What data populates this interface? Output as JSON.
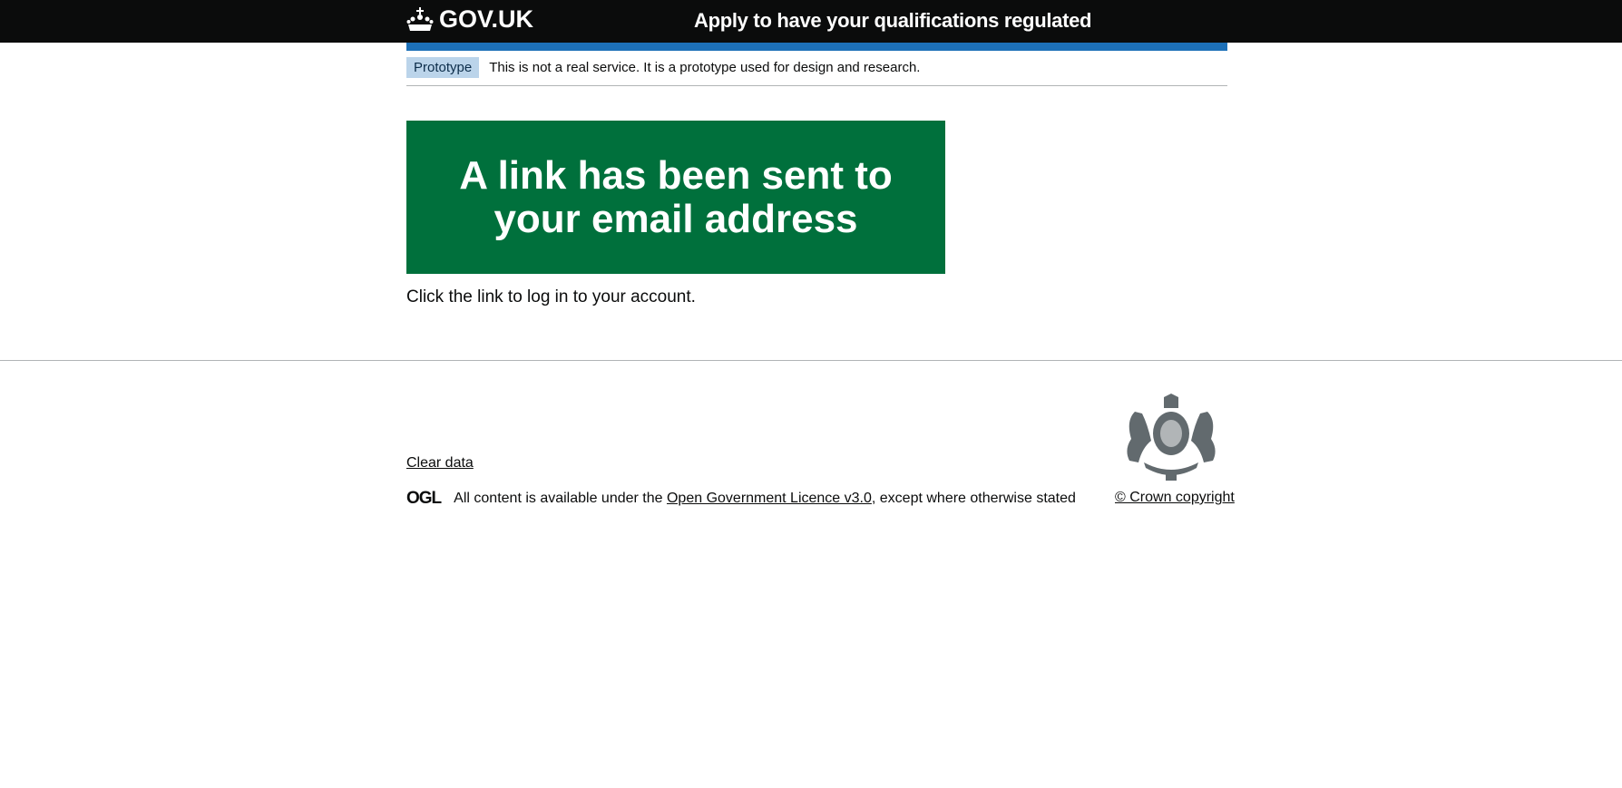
{
  "header": {
    "logo_text": "GOV.UK",
    "service_name": "Apply to have your qualifications regulated"
  },
  "phase_banner": {
    "tag": "Prototype",
    "text": "This is not a real service. It is a prototype used for design and research."
  },
  "panel": {
    "title": "A link has been sent to your email address"
  },
  "body": {
    "text": "Click the link to log in to your account."
  },
  "footer": {
    "clear_data": "Clear data",
    "ogl_logo": "OGL",
    "licence_prefix": "All content is available under the ",
    "licence_link": "Open Government Licence v3.0",
    "licence_suffix": ", except where otherwise stated",
    "copyright": "© Crown copyright"
  },
  "colors": {
    "header": "#0b0c0c",
    "blue": "#1d70b8",
    "panel": "#00703c"
  }
}
